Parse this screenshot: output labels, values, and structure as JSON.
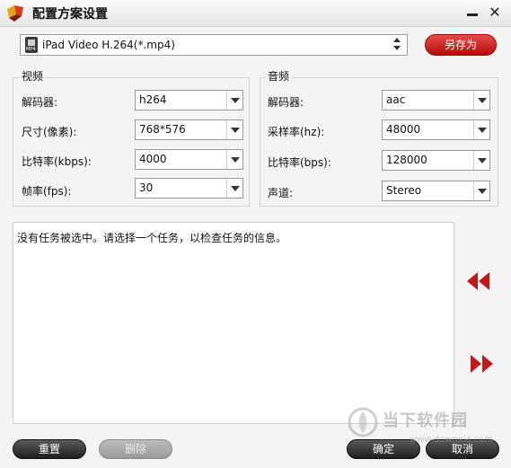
{
  "window": {
    "title": "配置方案设置",
    "minimize_icon": "minimize-icon",
    "close_icon": "close-icon",
    "close_glyph": "✕"
  },
  "preset": {
    "value": "iPad Video H.264(*.mp4)",
    "save_as_label": "另存为"
  },
  "video": {
    "group_label": "视频",
    "fields": [
      {
        "label": "解码器:",
        "value": "h264"
      },
      {
        "label": "尺寸(像素):",
        "value": "768*576"
      },
      {
        "label": "比特率(kbps):",
        "value": "4000"
      },
      {
        "label": "帧率(fps):",
        "value": "30"
      }
    ]
  },
  "audio": {
    "group_label": "音频",
    "fields": [
      {
        "label": "解码器:",
        "value": "aac"
      },
      {
        "label": "采样率(hz):",
        "value": "48000"
      },
      {
        "label": "比特率(bps):",
        "value": "128000"
      },
      {
        "label": "声道:",
        "value": "Stereo"
      }
    ]
  },
  "info": {
    "message": "没有任务被选中。请选择一个任务，以检查任务的信息。"
  },
  "footer": {
    "reset_label": "重置",
    "delete_label": "删除",
    "ok_label": "确定",
    "cancel_label": "取消"
  },
  "watermark": {
    "text": "当下软件园",
    "url": "www.downxia.com"
  },
  "colors": {
    "accent_red": "#c81414",
    "nav_arrow_red": "#c0191b",
    "dark_button": "#2a2a2a"
  }
}
